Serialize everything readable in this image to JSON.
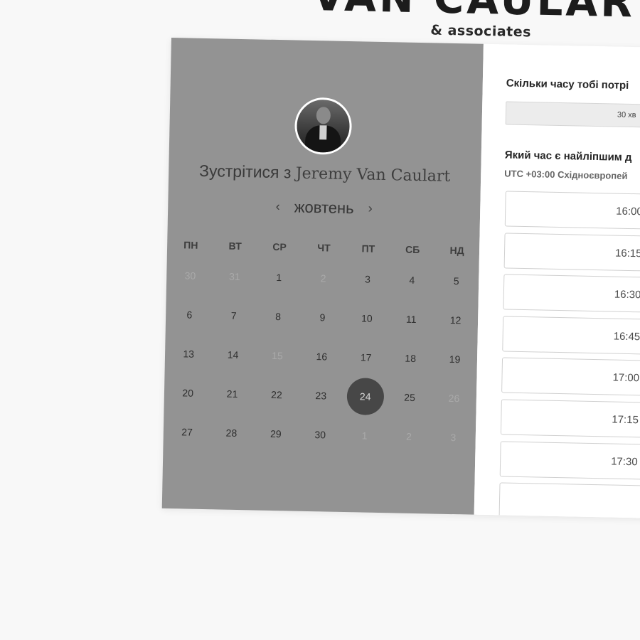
{
  "brand": {
    "name": "VAN CAULART",
    "subtitle": "& associates"
  },
  "scheduler": {
    "title_prefix": "Зустрітися з",
    "host_name": "Jeremy Van Caulart",
    "month": "жовтень",
    "prev_arrow": "‹",
    "next_arrow": "›",
    "weekdays": [
      "ПН",
      "ВТ",
      "СР",
      "ЧТ",
      "ПТ",
      "СБ",
      "НД"
    ],
    "weeks": [
      [
        "30",
        "31",
        "1",
        "2",
        "3",
        "4",
        "5"
      ],
      [
        "6",
        "7",
        "8",
        "9",
        "10",
        "11",
        "12"
      ],
      [
        "13",
        "14",
        "15",
        "16",
        "17",
        "18",
        "19"
      ],
      [
        "20",
        "21",
        "22",
        "23",
        "24",
        "25",
        "26"
      ],
      [
        "27",
        "28",
        "29",
        "30",
        "1",
        "2",
        "3"
      ]
    ],
    "selected_day": "24"
  },
  "booking": {
    "duration_question": "Скільки часу тобі потрі",
    "duration_value": "30 хв",
    "time_question": "Який час є найліпшим д",
    "timezone": "UTC +03:00 Східноєвропей",
    "slots": [
      "16:00",
      "16:15",
      "16:30",
      "16:45",
      "17:00",
      "17:15",
      "17:30",
      ""
    ]
  },
  "colors": {
    "left_panel": "#939393",
    "selected_day_bg": "#474747",
    "background": "#f8f8f8"
  }
}
